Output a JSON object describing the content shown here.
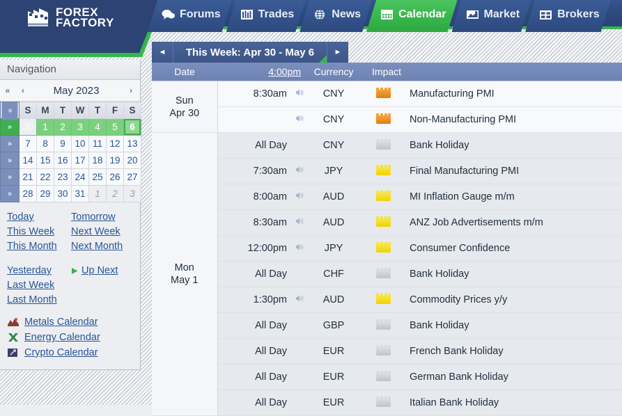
{
  "site": {
    "logo_line1": "FOREX",
    "logo_line2": "FACTORY",
    "logo_icon": "forex-factory-logo-icon"
  },
  "nav_tabs": [
    {
      "label": "Forums",
      "icon": "speech-bubble-icon",
      "active": false
    },
    {
      "label": "Trades",
      "icon": "bar-chart-icon",
      "active": false
    },
    {
      "label": "News",
      "icon": "globe-icon",
      "active": false
    },
    {
      "label": "Calendar",
      "icon": "calendar-icon",
      "active": true
    },
    {
      "label": "Market",
      "icon": "chart-line-icon",
      "active": false
    },
    {
      "label": "Brokers",
      "icon": "building-icon",
      "active": false
    }
  ],
  "sidebar": {
    "title": "Navigation",
    "mini_calendar": {
      "first_arrow": "«",
      "prev_arrow": "‹",
      "next_arrow": "›",
      "month_label": "May 2023",
      "week_toggle": "»",
      "dow": [
        "S",
        "M",
        "T",
        "W",
        "T",
        "F",
        "S"
      ],
      "weeks": [
        {
          "selector": "»",
          "highlight": true,
          "days": [
            {
              "n": "30",
              "other": true,
              "sel": false
            },
            {
              "n": "1",
              "other": false,
              "sel": false
            },
            {
              "n": "2",
              "other": false,
              "sel": false
            },
            {
              "n": "3",
              "other": false,
              "sel": false
            },
            {
              "n": "4",
              "other": false,
              "sel": false
            },
            {
              "n": "5",
              "other": false,
              "sel": false
            },
            {
              "n": "6",
              "other": false,
              "sel": true
            }
          ]
        },
        {
          "selector": "»",
          "highlight": false,
          "days": [
            {
              "n": "7",
              "other": false
            },
            {
              "n": "8",
              "other": false
            },
            {
              "n": "9",
              "other": false
            },
            {
              "n": "10",
              "other": false
            },
            {
              "n": "11",
              "other": false
            },
            {
              "n": "12",
              "other": false
            },
            {
              "n": "13",
              "other": false
            }
          ]
        },
        {
          "selector": "»",
          "highlight": false,
          "days": [
            {
              "n": "14",
              "other": false
            },
            {
              "n": "15",
              "other": false
            },
            {
              "n": "16",
              "other": false
            },
            {
              "n": "17",
              "other": false
            },
            {
              "n": "18",
              "other": false
            },
            {
              "n": "19",
              "other": false
            },
            {
              "n": "20",
              "other": false
            }
          ]
        },
        {
          "selector": "»",
          "highlight": false,
          "days": [
            {
              "n": "21",
              "other": false
            },
            {
              "n": "22",
              "other": false
            },
            {
              "n": "23",
              "other": false
            },
            {
              "n": "24",
              "other": false
            },
            {
              "n": "25",
              "other": false
            },
            {
              "n": "26",
              "other": false
            },
            {
              "n": "27",
              "other": false
            }
          ]
        },
        {
          "selector": "»",
          "highlight": false,
          "days": [
            {
              "n": "28",
              "other": false
            },
            {
              "n": "29",
              "other": false
            },
            {
              "n": "30",
              "other": false
            },
            {
              "n": "31",
              "other": false
            },
            {
              "n": "1",
              "other": true
            },
            {
              "n": "2",
              "other": true
            },
            {
              "n": "3",
              "other": true
            }
          ]
        }
      ]
    },
    "quick_links": [
      {
        "left": "Today",
        "right": "Tomorrow",
        "right_icon": ""
      },
      {
        "left": "This Week",
        "right": "Next Week",
        "right_icon": ""
      },
      {
        "left": "This Month",
        "right": "Next Month",
        "right_icon": ""
      }
    ],
    "quick_links2": [
      {
        "left": "Yesterday",
        "right": "Up Next",
        "right_icon": "green-play-icon"
      },
      {
        "left": "Last Week",
        "right": "",
        "right_icon": ""
      },
      {
        "left": "Last Month",
        "right": "",
        "right_icon": ""
      }
    ],
    "other_calendars": [
      {
        "label": "Metals Calendar",
        "icon": "metals-icon",
        "color": "#8c3b33"
      },
      {
        "label": "Energy Calendar",
        "icon": "energy-icon",
        "color": "#2e8b4a"
      },
      {
        "label": "Crypto Calendar",
        "icon": "crypto-icon",
        "color": "#3c3f6b"
      }
    ]
  },
  "calendar": {
    "prev_arrow": "◄",
    "next_arrow": "►",
    "title": "This Week: Apr 30 - May 6",
    "columns": {
      "date": "Date",
      "time": "4:00pm",
      "currency": "Currency",
      "impact": "Impact"
    },
    "rows": [
      {
        "date_line1": "Sun",
        "date_line2": "Apr 30",
        "date_span": 2,
        "time": "8:30am",
        "sound": true,
        "currency": "CNY",
        "impact": "orange",
        "event": "Manufacturing PMI",
        "shade": "lt",
        "daysep": true
      },
      {
        "date_line1": "",
        "date_line2": "",
        "date_span": 0,
        "time": "",
        "sound": true,
        "currency": "CNY",
        "impact": "orange",
        "event": "Non-Manufacturing PMI",
        "shade": "lt",
        "daysep": false
      },
      {
        "date_line1": "Mon",
        "date_line2": "May 1",
        "date_span": 11,
        "time": "All Day",
        "sound": false,
        "currency": "CNY",
        "impact": "gray",
        "event": "Bank Holiday",
        "shade": "dk",
        "daysep": true
      },
      {
        "date_line1": "",
        "date_line2": "",
        "date_span": 0,
        "time": "7:30am",
        "sound": true,
        "currency": "JPY",
        "impact": "yellow",
        "event": "Final Manufacturing PMI",
        "shade": "dk",
        "daysep": false
      },
      {
        "date_line1": "",
        "date_line2": "",
        "date_span": 0,
        "time": "8:00am",
        "sound": true,
        "currency": "AUD",
        "impact": "yellow",
        "event": "MI Inflation Gauge m/m",
        "shade": "dk",
        "daysep": false
      },
      {
        "date_line1": "",
        "date_line2": "",
        "date_span": 0,
        "time": "8:30am",
        "sound": true,
        "currency": "AUD",
        "impact": "yellow",
        "event": "ANZ Job Advertisements m/m",
        "shade": "dk",
        "daysep": false
      },
      {
        "date_line1": "",
        "date_line2": "",
        "date_span": 0,
        "time": "12:00pm",
        "sound": true,
        "currency": "JPY",
        "impact": "yellow",
        "event": "Consumer Confidence",
        "shade": "dk",
        "daysep": false
      },
      {
        "date_line1": "",
        "date_line2": "",
        "date_span": 0,
        "time": "All Day",
        "sound": false,
        "currency": "CHF",
        "impact": "gray",
        "event": "Bank Holiday",
        "shade": "dk",
        "daysep": false
      },
      {
        "date_line1": "",
        "date_line2": "",
        "date_span": 0,
        "time": "1:30pm",
        "sound": true,
        "currency": "AUD",
        "impact": "yellow",
        "event": "Commodity Prices y/y",
        "shade": "dk",
        "daysep": false
      },
      {
        "date_line1": "",
        "date_line2": "",
        "date_span": 0,
        "time": "All Day",
        "sound": false,
        "currency": "GBP",
        "impact": "gray",
        "event": "Bank Holiday",
        "shade": "dk",
        "daysep": false
      },
      {
        "date_line1": "",
        "date_line2": "",
        "date_span": 0,
        "time": "All Day",
        "sound": false,
        "currency": "EUR",
        "impact": "gray",
        "event": "French Bank Holiday",
        "shade": "dk",
        "daysep": false
      },
      {
        "date_line1": "",
        "date_line2": "",
        "date_span": 0,
        "time": "All Day",
        "sound": false,
        "currency": "EUR",
        "impact": "gray",
        "event": "German Bank Holiday",
        "shade": "dk",
        "daysep": false
      },
      {
        "date_line1": "",
        "date_line2": "",
        "date_span": 0,
        "time": "All Day",
        "sound": false,
        "currency": "EUR",
        "impact": "gray",
        "event": "Italian Bank Holiday",
        "shade": "dk",
        "daysep": false
      }
    ]
  }
}
